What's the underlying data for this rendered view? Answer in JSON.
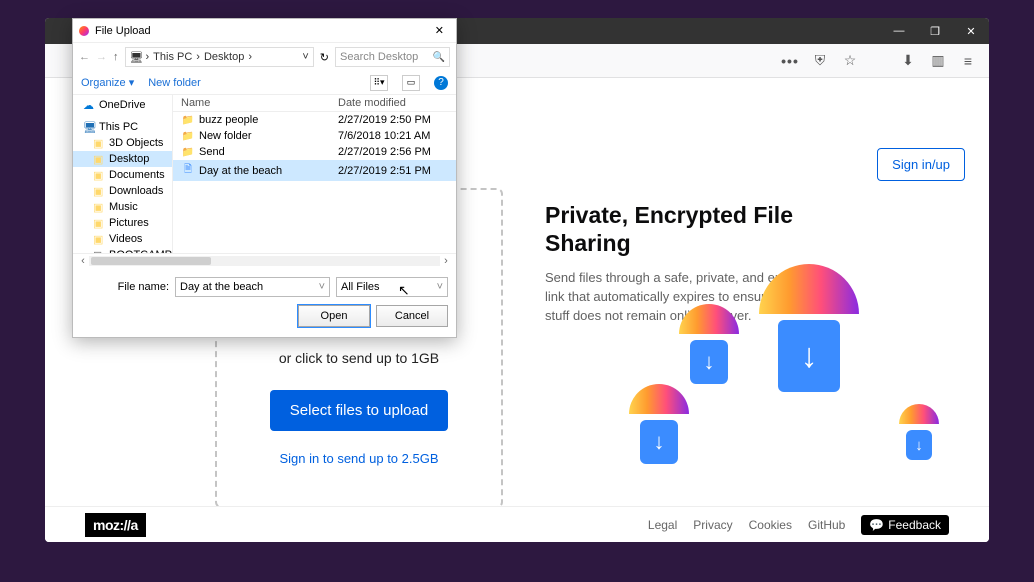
{
  "browser": {
    "toolbar_icons": {
      "bookmark": "☆",
      "pocket": "⌂",
      "download": "⬇",
      "library": "▥",
      "menu": "≡"
    }
  },
  "page": {
    "signin_button": "Sign in/up",
    "drop_hint": "or click to send up to 1GB",
    "select_button": "Select files to upload",
    "signin_link": "Sign in to send up to 2.5GB",
    "headline": "Private, Encrypted File Sharing",
    "description": "Send files through a safe, private, and encrypted link that automatically expires to ensure your stuff does not remain online forever.",
    "mozilla": "moz://a",
    "footer": {
      "legal": "Legal",
      "privacy": "Privacy",
      "cookies": "Cookies",
      "github": "GitHub",
      "feedback": "Feedback"
    }
  },
  "dialog": {
    "title": "File Upload",
    "breadcrumb": {
      "pc": "This PC",
      "loc": "Desktop"
    },
    "refresh_icon": "↻",
    "search_placeholder": "Search Desktop",
    "organize": "Organize ▾",
    "new_folder": "New folder",
    "tree": {
      "onedrive": "OneDrive",
      "this_pc": "This PC",
      "items": [
        "3D Objects",
        "Desktop",
        "Documents",
        "Downloads",
        "Music",
        "Pictures",
        "Videos",
        "BOOTCAMP (C:)"
      ]
    },
    "columns": {
      "name": "Name",
      "date": "Date modified"
    },
    "rows": [
      {
        "icon": "folder",
        "name": "buzz people",
        "date": "2/27/2019 2:50 PM"
      },
      {
        "icon": "folder",
        "name": "New folder",
        "date": "7/6/2018 10:21 AM"
      },
      {
        "icon": "folder",
        "name": "Send",
        "date": "2/27/2019 2:56 PM"
      },
      {
        "icon": "file",
        "name": "Day at the beach",
        "date": "2/27/2019 2:51 PM"
      }
    ],
    "filename_label": "File name:",
    "filename_value": "Day at the beach",
    "type_select": "All Files",
    "open": "Open",
    "cancel": "Cancel"
  }
}
